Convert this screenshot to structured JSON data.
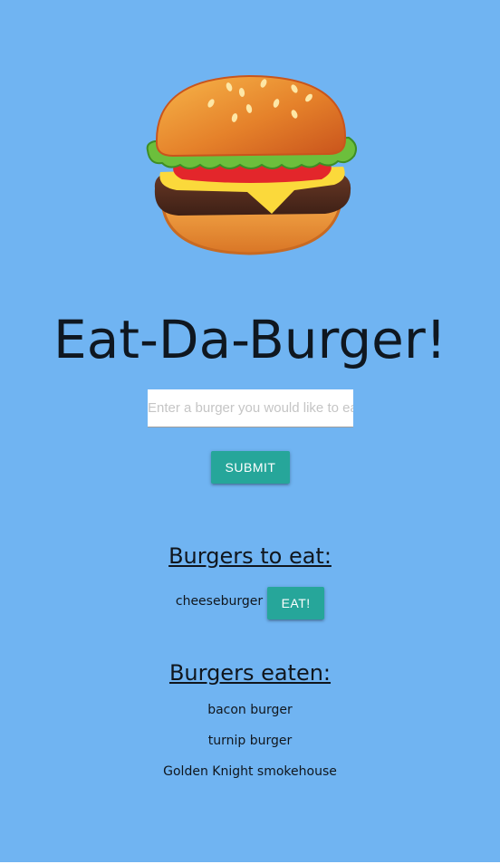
{
  "header": {
    "title": "Eat-Da-Burger!",
    "logo_icon": "hamburger-icon"
  },
  "form": {
    "input_placeholder": "Enter a burger you would like to eat",
    "input_value": "",
    "submit_label": "SUBMIT"
  },
  "to_eat": {
    "heading": "Burgers to eat:",
    "items": [
      {
        "name": "cheeseburger",
        "button_label": "EAT!"
      }
    ]
  },
  "eaten": {
    "heading": "Burgers eaten:",
    "items": [
      "bacon burger",
      "turnip burger",
      "Golden Knight smokehouse"
    ]
  },
  "colors": {
    "background": "#70b4f2",
    "button": "#26a69a",
    "text": "#10161d"
  }
}
